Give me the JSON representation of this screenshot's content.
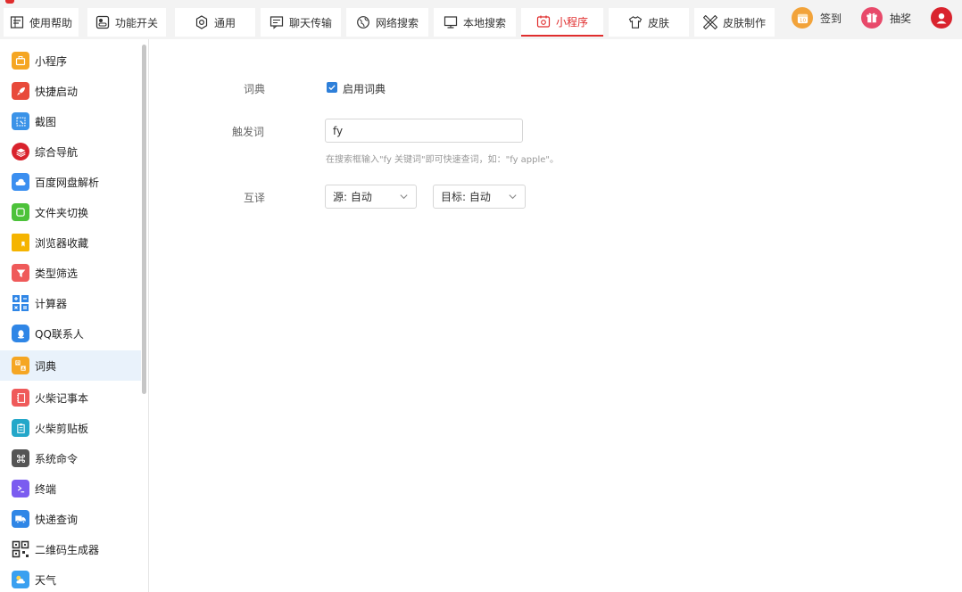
{
  "tabs": [
    {
      "label": "使用帮助",
      "icon": "help-doc-icon"
    },
    {
      "label": "功能开关",
      "icon": "toggle-switch-icon"
    },
    {
      "label": "通用",
      "icon": "gear-icon"
    },
    {
      "label": "聊天传输",
      "icon": "chat-transfer-icon"
    },
    {
      "label": "网络搜索",
      "icon": "globe-search-icon"
    },
    {
      "label": "本地搜索",
      "icon": "monitor-icon"
    },
    {
      "label": "小程序",
      "icon": "mini-program-icon",
      "active": true
    },
    {
      "label": "皮肤",
      "icon": "tshirt-icon"
    },
    {
      "label": "皮肤制作",
      "icon": "brush-ruler-icon"
    }
  ],
  "actions": {
    "checkin": {
      "label": "签到",
      "badge_text": "10",
      "color": "#f2a33a"
    },
    "lottery": {
      "label": "抽奖",
      "color": "#e8496a"
    },
    "account": {
      "color": "#d9232d"
    }
  },
  "sidebar": {
    "items": [
      {
        "label": "小程序",
        "color": "#f5a623"
      },
      {
        "label": "快捷启动",
        "color": "#e84a3b"
      },
      {
        "label": "截图",
        "color": "#3b93e8"
      },
      {
        "label": "综合导航",
        "color": "#d9232d"
      },
      {
        "label": "百度网盘解析",
        "color": "#3b8ff0"
      },
      {
        "label": "文件夹切换",
        "color": "#4cc23a"
      },
      {
        "label": "浏览器收藏",
        "color": "#f5b400"
      },
      {
        "label": "类型筛选",
        "color": "#ef5a5a"
      },
      {
        "label": "计算器",
        "color": "#2f86e6"
      },
      {
        "label": "QQ联系人",
        "color": "#2f86e6"
      },
      {
        "label": "词典",
        "color": "#f5a623",
        "active": true
      },
      {
        "label": "火柴记事本",
        "color": "#ef5a5a"
      },
      {
        "label": "火柴剪贴板",
        "color": "#24a7c9"
      },
      {
        "label": "系统命令",
        "color": "#555555"
      },
      {
        "label": "终端",
        "color": "#7b5cf0"
      },
      {
        "label": "快递查询",
        "color": "#2f86e6"
      },
      {
        "label": "二维码生成器",
        "color": "#333333"
      },
      {
        "label": "天气",
        "color": "#3aa0f0"
      }
    ]
  },
  "settings": {
    "dict": {
      "label": "词典",
      "checkbox_label": "启用词典",
      "checked": true
    },
    "trigger": {
      "label": "触发词",
      "value": "fy",
      "hint": "在搜索框输入\"fy 关键词\"即可快速查词，如：\"fy apple\"。"
    },
    "translate": {
      "label": "互译",
      "source": "源: 自动",
      "target": "目标: 自动"
    }
  },
  "colors": {
    "accent": "#e02d2d",
    "blue": "#2e7fd9"
  }
}
